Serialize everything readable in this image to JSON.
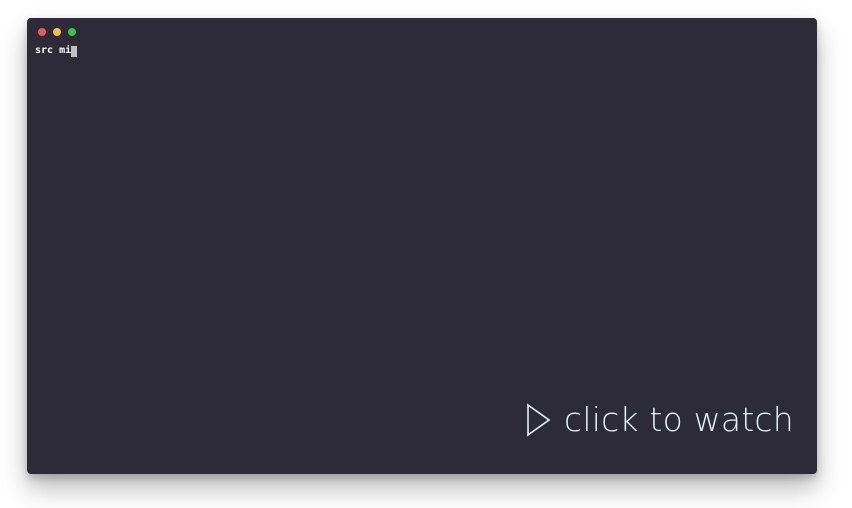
{
  "window": {
    "traffic_lights": [
      {
        "name": "close",
        "color": "#ed5a5e"
      },
      {
        "name": "minimize",
        "color": "#f2c041"
      },
      {
        "name": "maximize",
        "color": "#37c64a"
      }
    ],
    "background_color": "#2d2b38"
  },
  "terminal": {
    "typed_text": "src mi",
    "cursor": "block"
  },
  "overlay": {
    "icon": "play-icon",
    "label": "click to watch",
    "color": "#e4f4fa"
  }
}
